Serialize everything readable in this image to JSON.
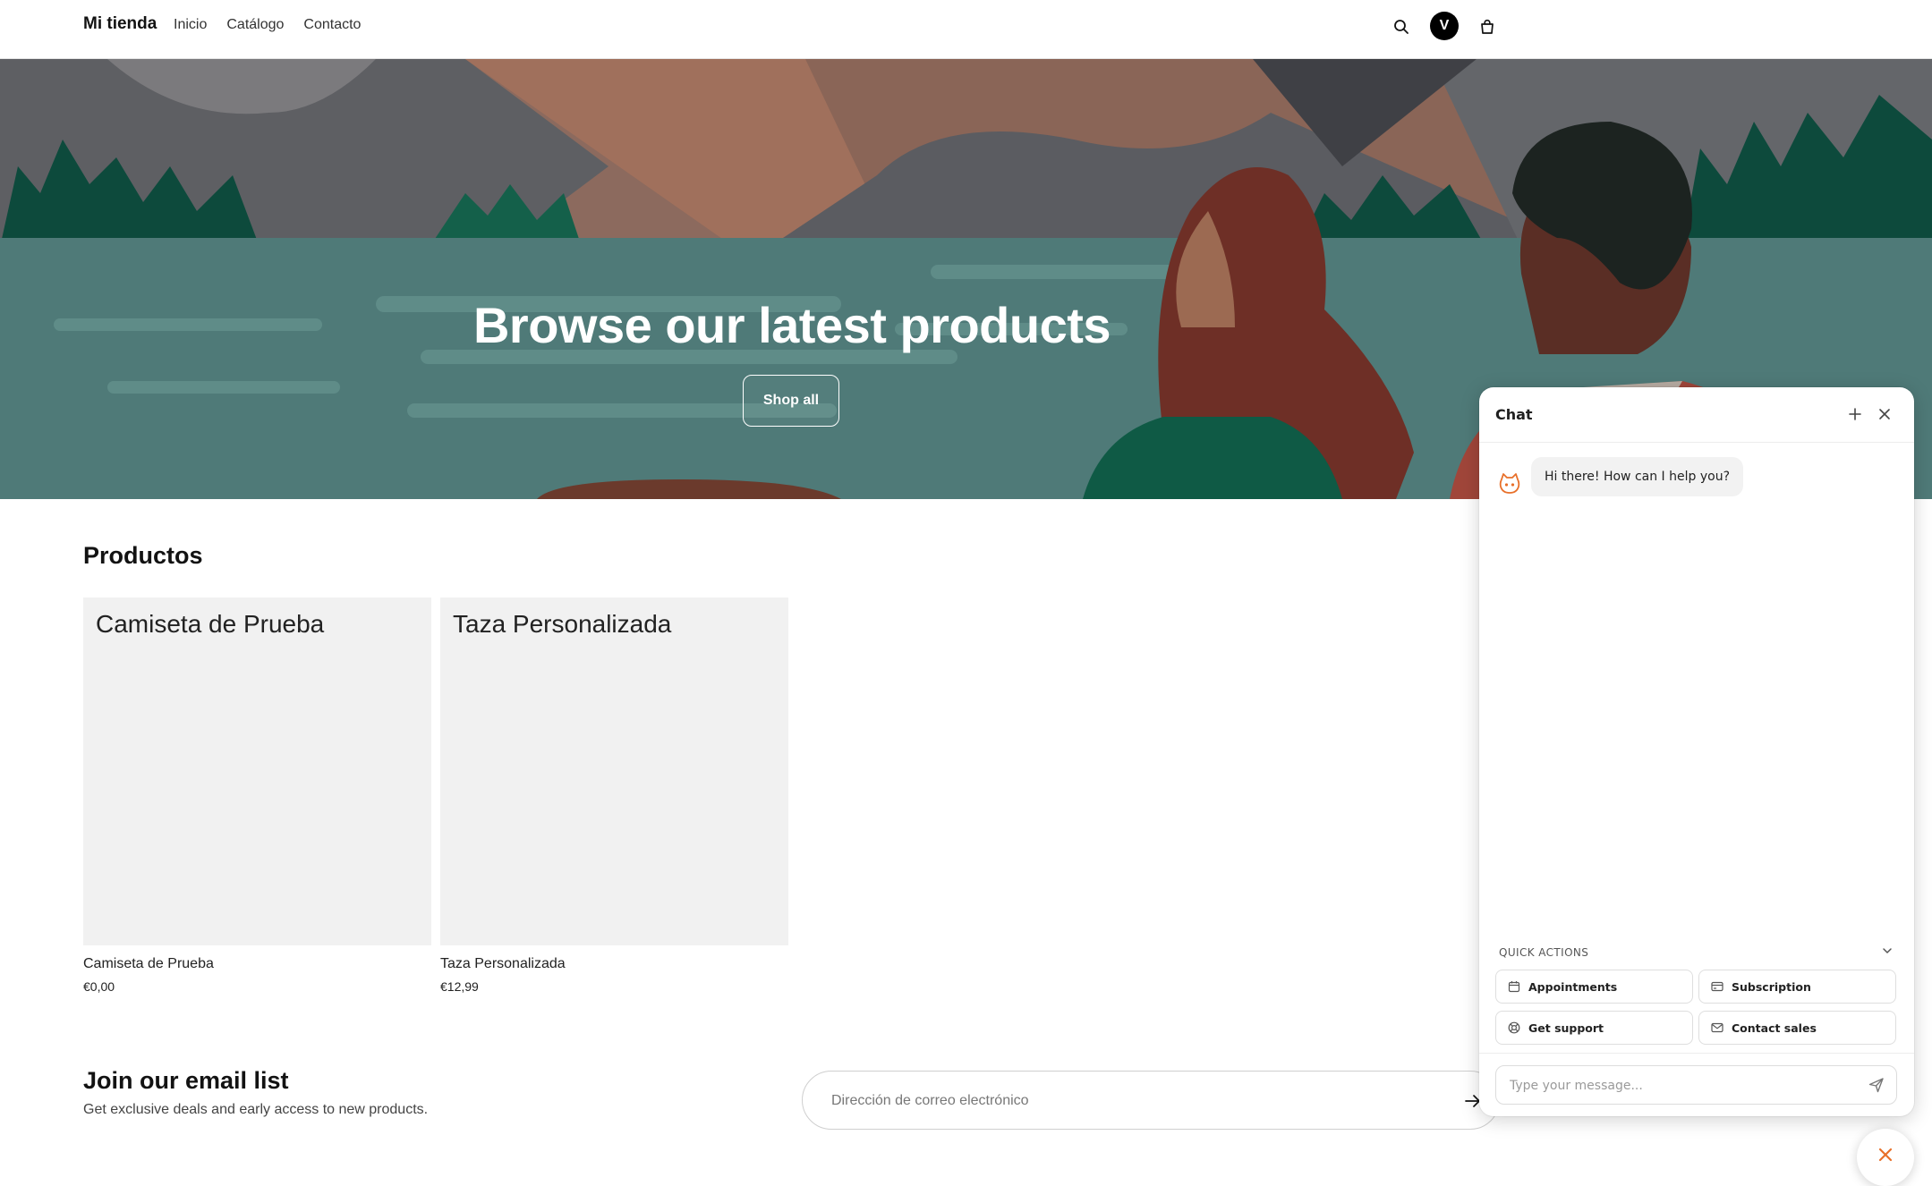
{
  "header": {
    "brand": "Mi tienda",
    "nav": [
      "Inicio",
      "Catálogo",
      "Contacto"
    ],
    "avatar_initial": "V",
    "icons": [
      "search-icon",
      "cart-icon"
    ]
  },
  "hero": {
    "title": "Browse our latest products",
    "button": "Shop all"
  },
  "products": {
    "title": "Productos",
    "items": [
      {
        "image_text": "Camiseta de Prueba",
        "name": "Camiseta de Prueba",
        "price": "€0,00"
      },
      {
        "image_text": "Taza Personalizada",
        "name": "Taza Personalizada",
        "price": "€12,99"
      }
    ]
  },
  "newsletter": {
    "title": "Join our email list",
    "subtitle": "Get exclusive deals and early access to new products.",
    "placeholder": "Dirección de correo electrónico"
  },
  "chat": {
    "title": "Chat",
    "greeting": "Hi there! How can I help you?",
    "quick_actions_label": "QUICK ACTIONS",
    "quick_actions": [
      {
        "label": "Appointments",
        "icon": "calendar-icon"
      },
      {
        "label": "Subscription",
        "icon": "card-icon"
      },
      {
        "label": "Get support",
        "icon": "lifebuoy-icon"
      },
      {
        "label": "Contact sales",
        "icon": "mail-icon"
      }
    ],
    "input_placeholder": "Type your message...",
    "accent_color": "#e8702a"
  }
}
